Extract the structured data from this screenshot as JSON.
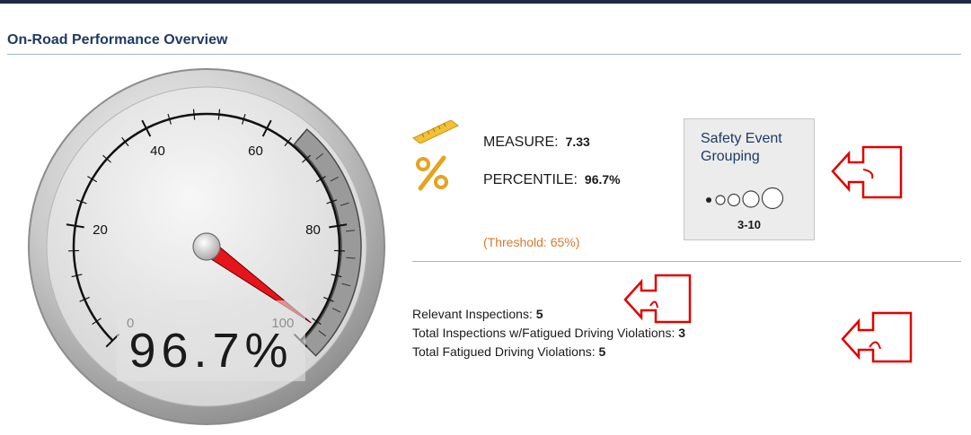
{
  "section": {
    "title": "On-Road Performance Overview"
  },
  "gauge": {
    "value_percent": 96.7,
    "readout": "96.7%",
    "min": 0,
    "max": 100,
    "tick_labels": [
      "0",
      "20",
      "40",
      "60",
      "80",
      "100"
    ],
    "red_zone_start": 65,
    "needle_color": "#e8141b"
  },
  "metrics": {
    "measure_label": "MEASURE:",
    "measure_value": "7.33",
    "percentile_label": "PERCENTILE:",
    "percentile_value": "96.7%",
    "threshold_text": "(Threshold: 65%)"
  },
  "segment": {
    "title_line1": "Safety Event",
    "title_line2": "Grouping",
    "range": "3-10"
  },
  "stats": [
    {
      "label": "Relevant Inspections:",
      "value": "5"
    },
    {
      "label": "Total Inspections w/Fatigued Driving Violations:",
      "value": "3"
    },
    {
      "label": "Total Fatigued Driving Violations:",
      "value": "5"
    }
  ],
  "colors": {
    "title": "#1f3b63",
    "threshold": "#d9782f",
    "callout": "#e10000",
    "divider": "#9fb6d1"
  }
}
